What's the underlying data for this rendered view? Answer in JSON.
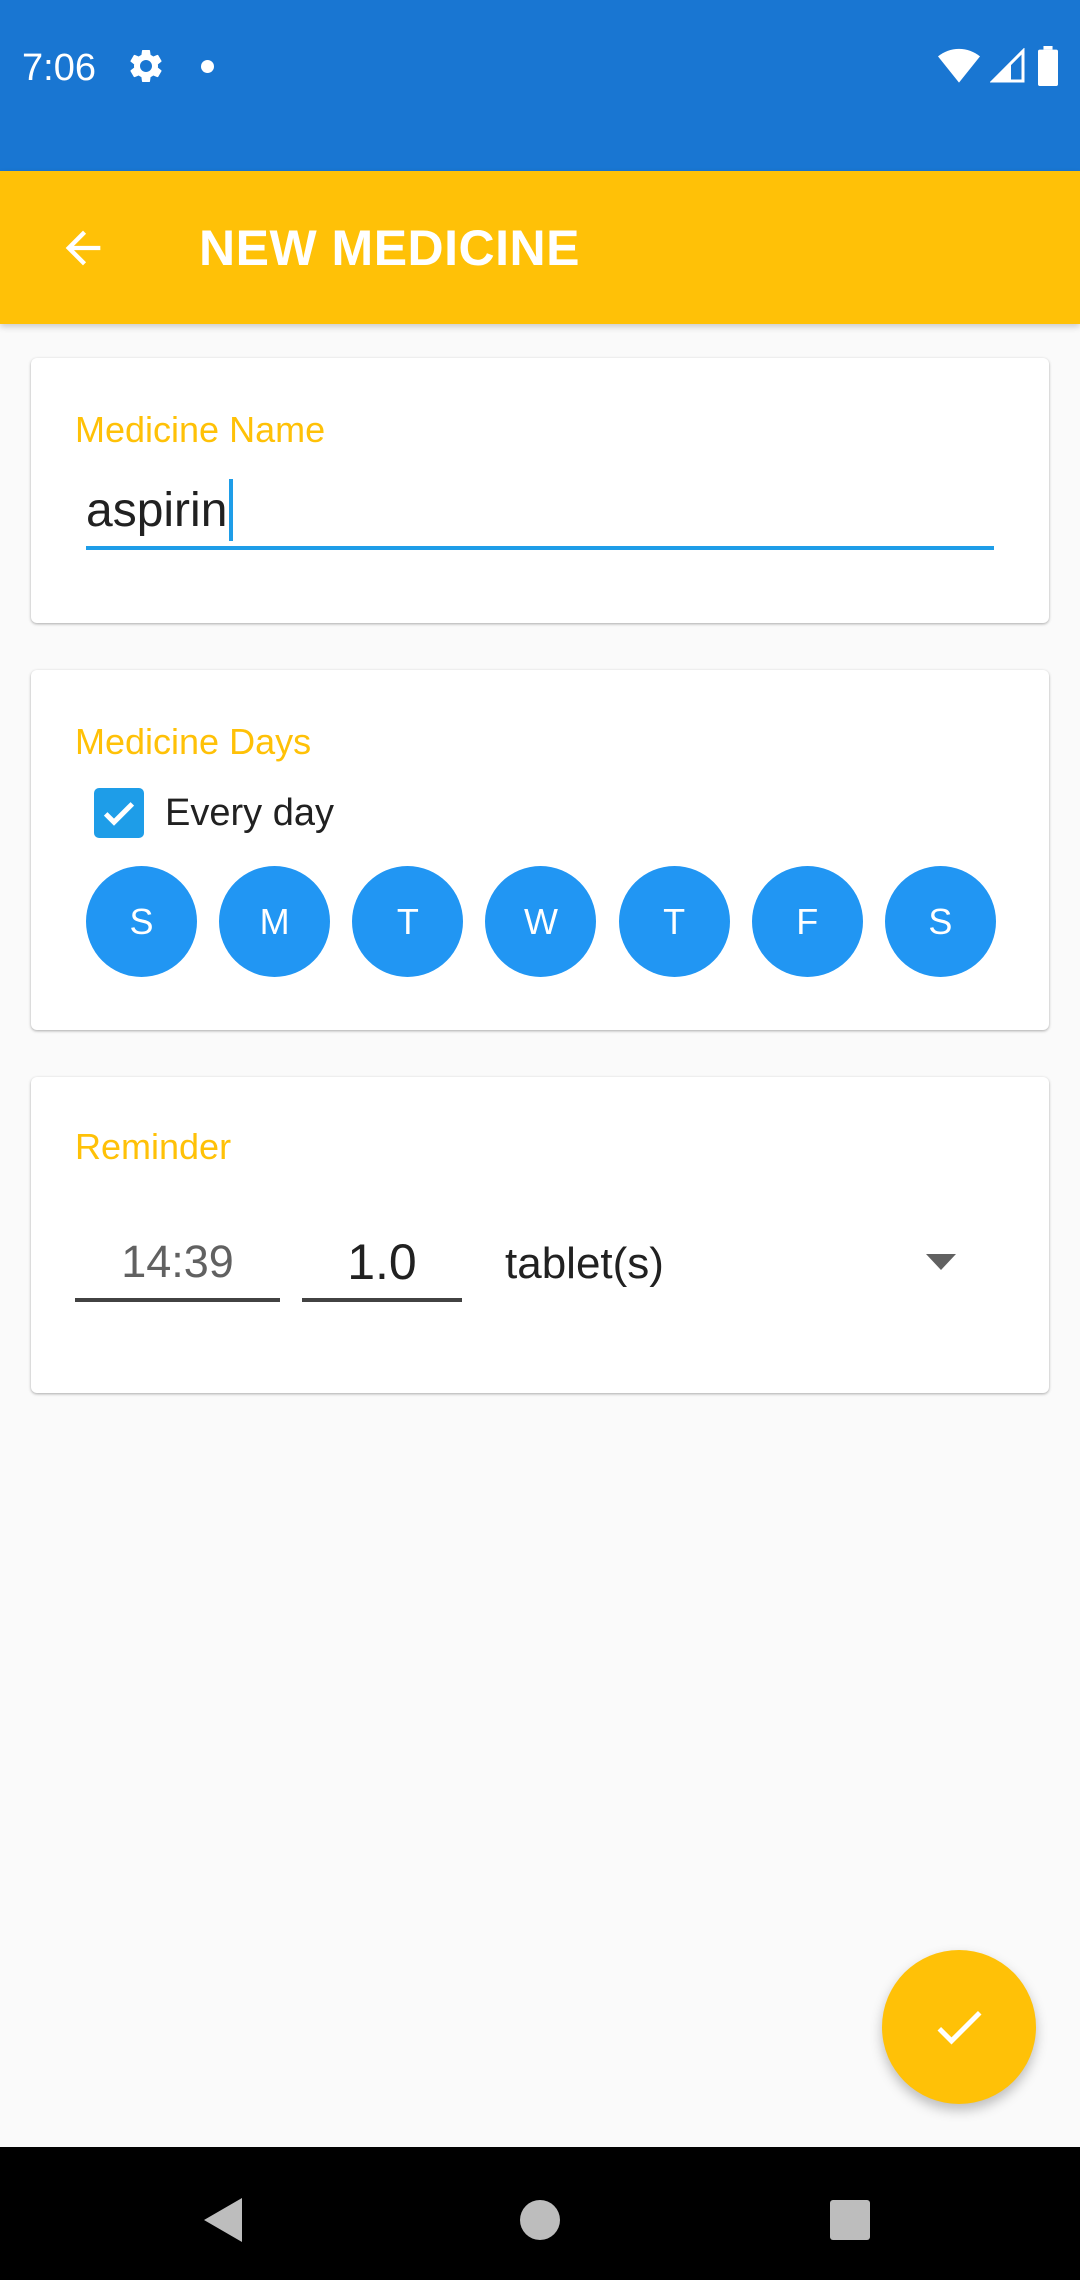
{
  "status_bar": {
    "time": "7:06",
    "icons": [
      "gear-icon",
      "notification-dot-icon",
      "wifi-icon",
      "signal-icon",
      "battery-icon"
    ],
    "background": "#1976d2"
  },
  "app_bar": {
    "title": "NEW MEDICINE",
    "back_icon": "arrow-back-icon",
    "background": "#ffc107"
  },
  "medicine_name": {
    "label": "Medicine Name",
    "value": "aspirin"
  },
  "medicine_days": {
    "label": "Medicine Days",
    "every_day_label": "Every day",
    "every_day_checked": true,
    "days": [
      {
        "label": "S"
      },
      {
        "label": "M"
      },
      {
        "label": "T"
      },
      {
        "label": "W"
      },
      {
        "label": "T"
      },
      {
        "label": "F"
      },
      {
        "label": "S"
      }
    ]
  },
  "reminder": {
    "label": "Reminder",
    "time": "14:39",
    "dose": "1.0",
    "unit": "tablet(s)",
    "dropdown_icon": "dropdown-arrow-icon"
  },
  "fab": {
    "icon": "check-icon"
  },
  "navigation": {
    "icons": [
      "back-triangle-icon",
      "home-circle-icon",
      "recents-square-icon"
    ]
  },
  "colors": {
    "accent": "#ffc107",
    "primary": "#1976d2",
    "day_circle": "#2196f3",
    "input_focus": "#1e9de8"
  }
}
